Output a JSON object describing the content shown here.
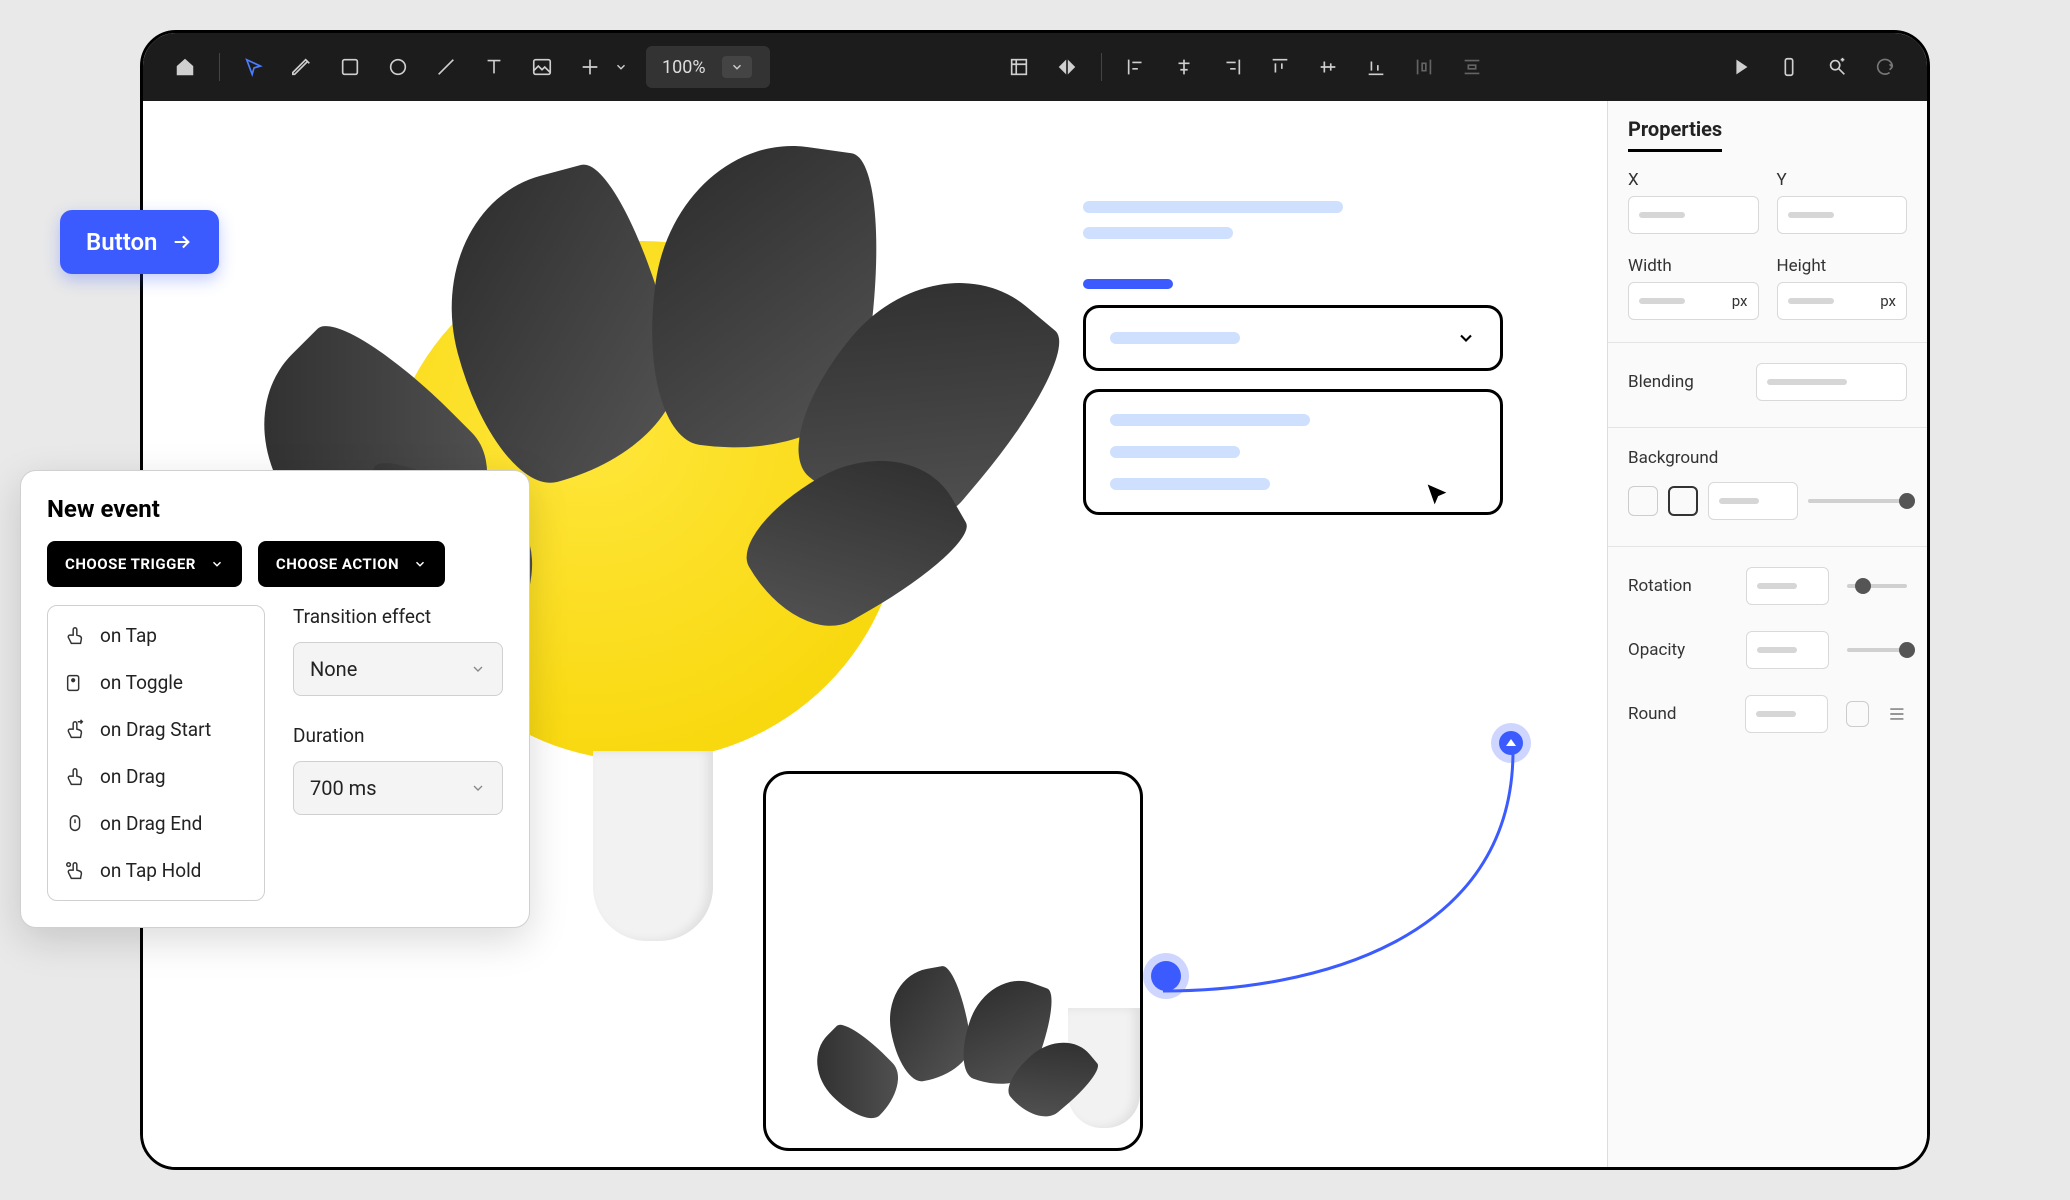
{
  "toolbar": {
    "zoom": "100%"
  },
  "button_overlay": {
    "label": "Button"
  },
  "new_event": {
    "title": "New event",
    "choose_trigger": "CHOOSE TRIGGER",
    "choose_action": "CHOOSE ACTION",
    "triggers": [
      "on Tap",
      "on Toggle",
      "on Drag Start",
      "on Drag",
      "on Drag End",
      "on Tap Hold"
    ],
    "transition_label": "Transition effect",
    "transition_value": "None",
    "duration_label": "Duration",
    "duration_value": "700 ms"
  },
  "properties": {
    "title": "Properties",
    "x_label": "X",
    "y_label": "Y",
    "width_label": "Width",
    "height_label": "Height",
    "px": "px",
    "blending_label": "Blending",
    "background_label": "Background",
    "rotation_label": "Rotation",
    "opacity_label": "Opacity",
    "round_label": "Round"
  }
}
